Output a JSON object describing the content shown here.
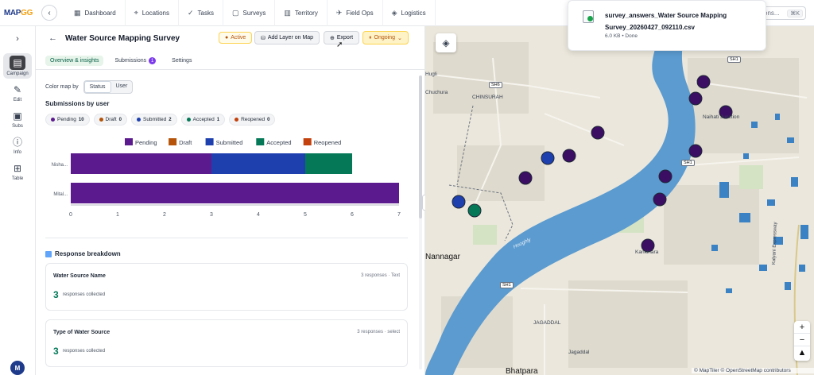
{
  "app": {
    "logo_main": "MAP",
    "logo_accent": "GG"
  },
  "nav": [
    {
      "icon": "grid-icon",
      "glyph": "▦",
      "label": "Dashboard"
    },
    {
      "icon": "pin-icon",
      "glyph": "⌖",
      "label": "Locations"
    },
    {
      "icon": "check-icon",
      "glyph": "✓",
      "label": "Tasks"
    },
    {
      "icon": "clipboard-icon",
      "glyph": "▢",
      "label": "Surveys"
    },
    {
      "icon": "map-icon",
      "glyph": "▥",
      "label": "Territory"
    },
    {
      "icon": "route-icon",
      "glyph": "✈",
      "label": "Field Ops"
    },
    {
      "icon": "box-icon",
      "glyph": "◈",
      "label": "Logistics"
    }
  ],
  "topsearch": {
    "text": "ons...",
    "shortcut": "⌘K"
  },
  "rail": [
    {
      "label": "Campaign",
      "glyph": "▤"
    },
    {
      "label": "Edit",
      "glyph": "✎"
    },
    {
      "label": "Subs",
      "glyph": "▣"
    },
    {
      "label": "Info",
      "glyph": "ⓘ"
    },
    {
      "label": "Table",
      "glyph": "⊞"
    }
  ],
  "user": {
    "initial": "M"
  },
  "panel": {
    "title": "Water Source Mapping Survey",
    "status_badge": "Active",
    "add_layer_label": "Add Layer on Map",
    "export_label": "Export",
    "ongoing_label": "Ongoing",
    "tabs": [
      {
        "label": "Overview & insights",
        "count": ""
      },
      {
        "label": "Submissions",
        "count": "1"
      },
      {
        "label": "Settings",
        "count": ""
      }
    ],
    "colormap": {
      "label": "Color map by",
      "options": [
        "Status",
        "User"
      ]
    },
    "submissions_heading": "Submissions by user",
    "chips": [
      {
        "label": "Pending",
        "count": "10",
        "color": "#5b1a8e"
      },
      {
        "label": "Draft",
        "count": "0",
        "color": "#b45309"
      },
      {
        "label": "Submitted",
        "count": "2",
        "color": "#1e40af"
      },
      {
        "label": "Accepted",
        "count": "1",
        "color": "#047857"
      },
      {
        "label": "Reopened",
        "count": "0",
        "color": "#c2410c"
      }
    ],
    "response_heading": "Response breakdown",
    "cards": [
      {
        "title": "Water Source Name",
        "meta": "3 responses · Text",
        "count": "3",
        "sub": "responses collected"
      },
      {
        "title": "Type of Water Source",
        "meta": "3 responses · select",
        "count": "3",
        "sub": "responses collected"
      }
    ]
  },
  "chart_data": {
    "type": "bar",
    "orientation": "horizontal",
    "stacked": true,
    "categories": [
      "Nisha...",
      "Mital..."
    ],
    "series": [
      {
        "name": "Pending",
        "values": [
          3,
          7
        ],
        "color": "#5b1a8e"
      },
      {
        "name": "Draft",
        "values": [
          0,
          0
        ],
        "color": "#b45309"
      },
      {
        "name": "Submitted",
        "values": [
          2,
          0
        ],
        "color": "#1e40af"
      },
      {
        "name": "Accepted",
        "values": [
          1,
          0
        ],
        "color": "#047857"
      },
      {
        "name": "Reopened",
        "values": [
          0,
          0
        ],
        "color": "#c2410c"
      }
    ],
    "xlim": [
      0,
      7
    ],
    "xticks": [
      "0",
      "1",
      "2",
      "3",
      "4",
      "5",
      "6",
      "7"
    ],
    "legend_position": "top",
    "grid": false
  },
  "map": {
    "labels": {
      "chinsurah": "CHINSURAH",
      "hugli": "Hugli",
      "chuchura": "Chuchura",
      "naihati": "Naihati Junction",
      "kankinara": "Kankinara",
      "jagaddal_caps": "JAGADDAL",
      "jagaddal": "Jagaddal",
      "nannagar": "Nannagar",
      "bhatpara": "Bhatpara",
      "expressway": "Kalyani Expressway",
      "sh6": "SH6",
      "sh1a": "SH1",
      "sh1b": "SH1",
      "sh1c": "SH1",
      "river": "Hooghly"
    },
    "attribution": "© MapTiler © OpenStreetMap contributors"
  },
  "toast": {
    "filename": "survey_answers_Water Source Mapping Survey_20260427_092110.csv",
    "status": "6.0 KB • Done"
  }
}
